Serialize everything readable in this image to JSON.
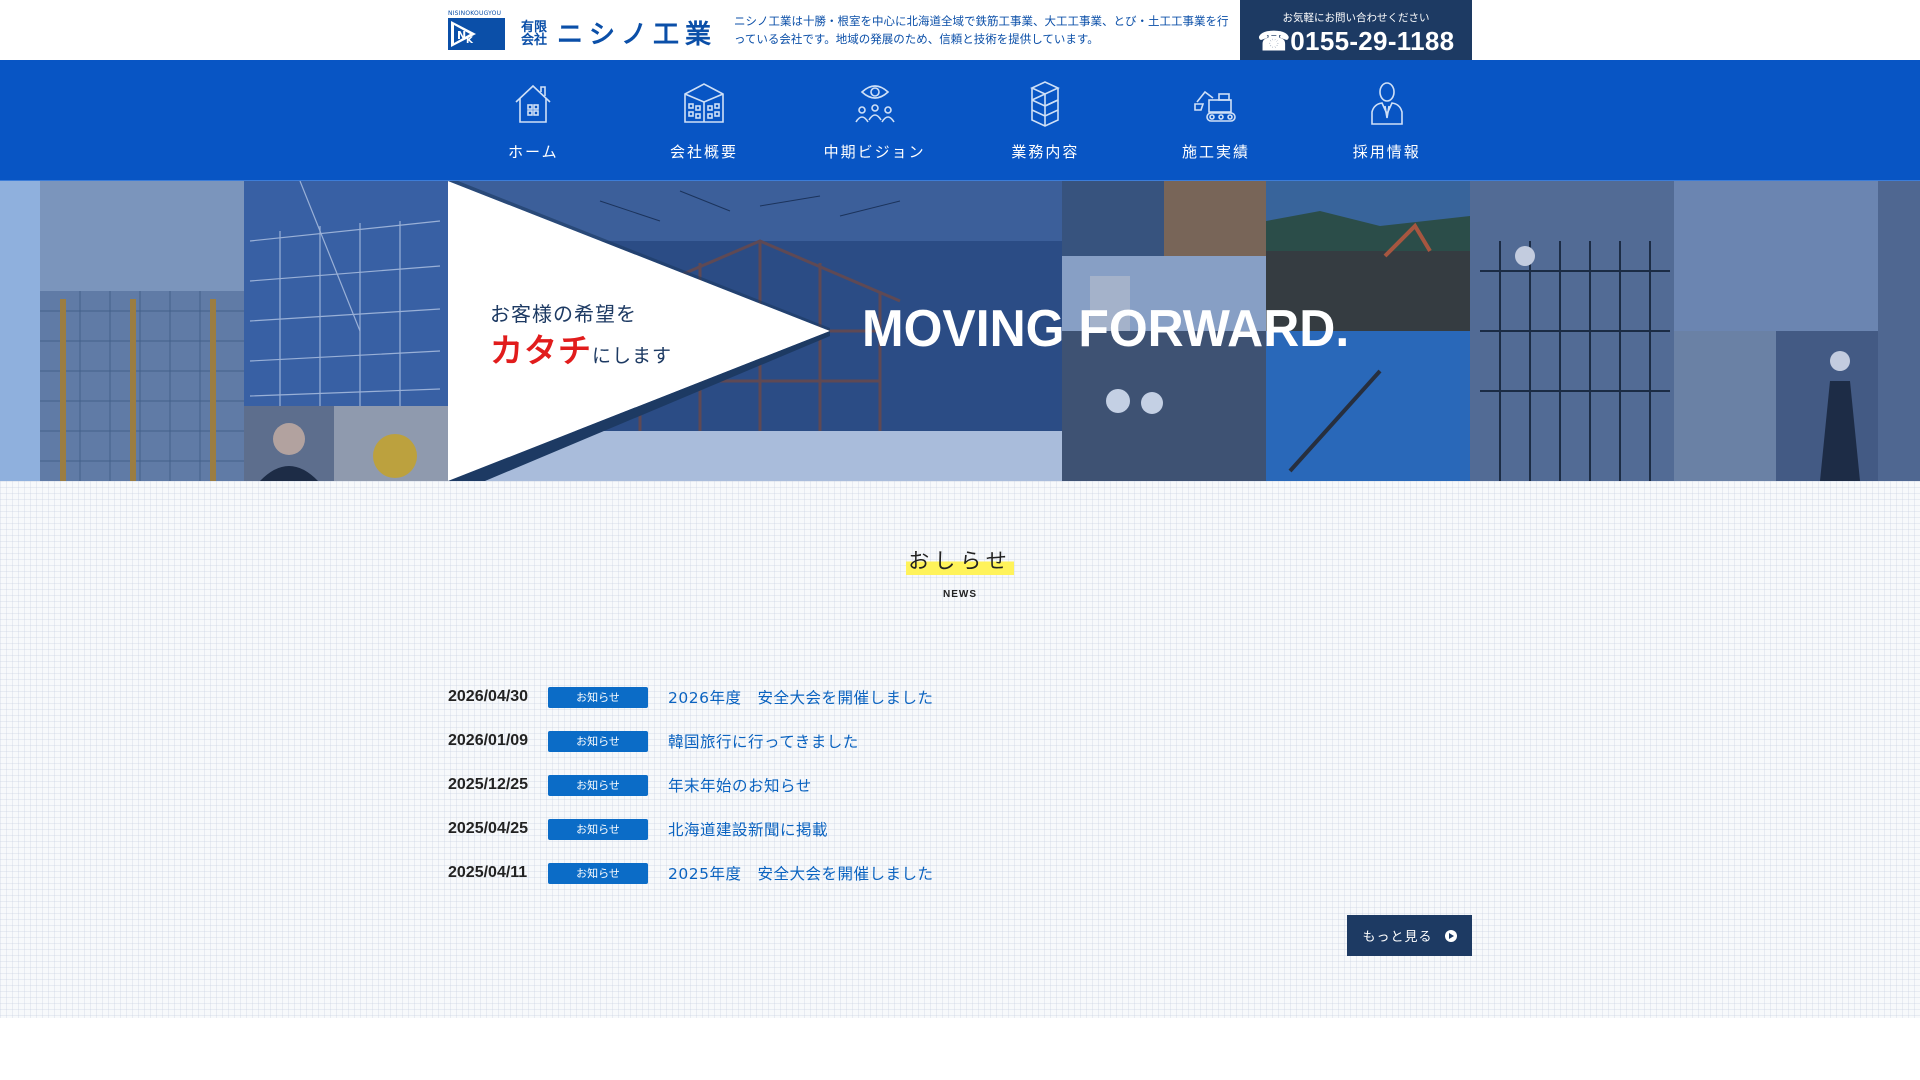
{
  "header": {
    "logo_tiny": "NISINOKOUGYOU",
    "logo_company_type": "有限会社",
    "logo_name": "ニシノ工業",
    "tagline": "ニシノ工業は十勝・根室を中心に北海道全域で鉄筋工事業、大工工事業、とび・土工工事業を行っている会社です。地域の発展のため、信頼と技術を提供しています。",
    "contact_lead": "お気軽にお問い合わせください",
    "tel": "☎0155-29-1188"
  },
  "nav": {
    "items": [
      {
        "label": "ホーム",
        "icon": "home-icon"
      },
      {
        "label": "会社概要",
        "icon": "building-icon"
      },
      {
        "label": "中期ビジョン",
        "icon": "vision-team-icon"
      },
      {
        "label": "業務内容",
        "icon": "scaffold-icon"
      },
      {
        "label": "施工実績",
        "icon": "excavator-icon"
      },
      {
        "label": "採用情報",
        "icon": "person-icon"
      }
    ]
  },
  "hero": {
    "catch_line1": "お客様の希望を",
    "catch_accent": "カタチ",
    "catch_suffix": "にします",
    "slogan": "MOVING FORWARD."
  },
  "news": {
    "title": "おしらせ",
    "subtitle": "NEWS",
    "items": [
      {
        "date": "2026/04/30",
        "category": "お知らせ",
        "title": "2026年度　安全大会を開催しました"
      },
      {
        "date": "2026/01/09",
        "category": "お知らせ",
        "title": "韓国旅行に行ってきました"
      },
      {
        "date": "2025/12/25",
        "category": "お知らせ",
        "title": "年末年始のお知らせ"
      },
      {
        "date": "2025/04/25",
        "category": "お知らせ",
        "title": "北海道建設新聞に掲載"
      },
      {
        "date": "2025/04/11",
        "category": "お知らせ",
        "title": "2025年度　安全大会を開催しました"
      }
    ],
    "more_label": "もっと見る"
  },
  "colors": {
    "nav_bg": "#0855c4",
    "brand_blue": "#0b4fa8",
    "contact_bg": "#1d3a63",
    "accent_red": "#e11c1c",
    "highlight_yellow": "#fff35a"
  }
}
